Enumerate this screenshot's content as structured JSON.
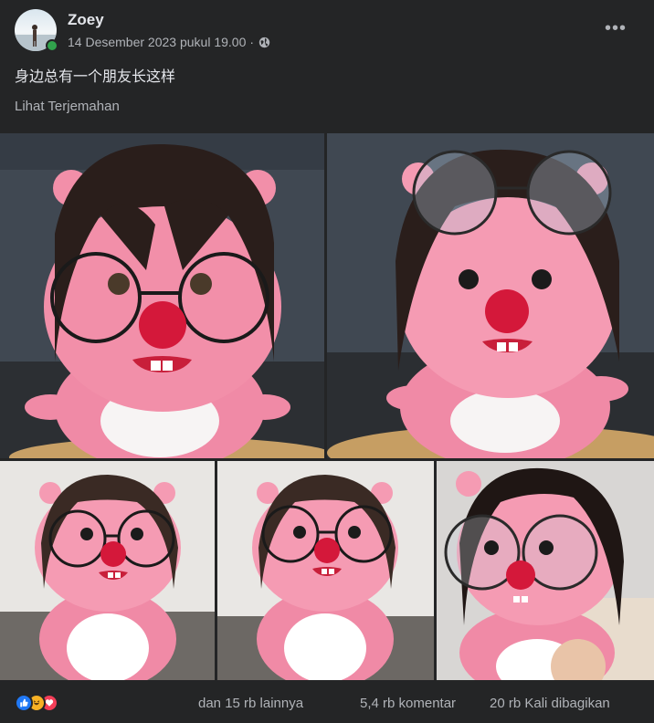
{
  "post": {
    "author": "Zoey",
    "timestamp": "14 Desember 2023 pukul 19.00",
    "separator": "·",
    "text": "身边总有一个朋友长这样",
    "translate_link": "Lihat Terjemahan",
    "more_label": "•••"
  },
  "photos": [
    {
      "subject": "pink plush doll with dark wig and round glasses"
    },
    {
      "subject": "pink plush doll with glasses on head"
    },
    {
      "subject": "pink plush doll with bangs and glasses"
    },
    {
      "subject": "pink plush doll with bangs and glasses"
    },
    {
      "subject": "pink plush doll with long hair and glasses held in hand"
    }
  ],
  "footer": {
    "reactions": [
      "like-icon",
      "haha-icon",
      "love-icon"
    ],
    "reaction_text": "dan 15 rb lainnya",
    "comments": "5,4 rb komentar",
    "shares": "20 rb Kali dibagikan"
  },
  "colors": {
    "background": "#242526",
    "text_primary": "#e4e6eb",
    "text_secondary": "#b0b3b8",
    "like": "#2078f4",
    "haha": "#f7b125",
    "love": "#f33e58",
    "online": "#31a24c",
    "plush_pink": "#f08aa6",
    "nose_red": "#d4183a"
  }
}
